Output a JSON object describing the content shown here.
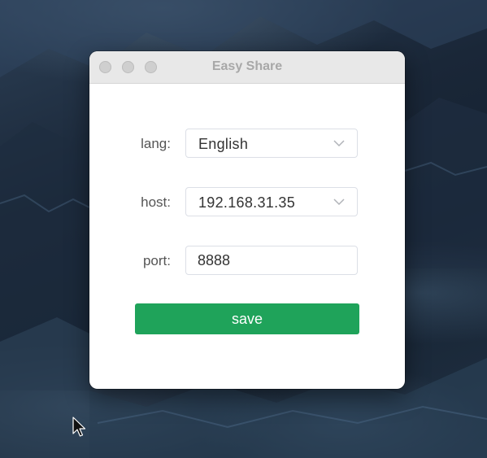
{
  "window": {
    "title": "Easy Share"
  },
  "form": {
    "lang": {
      "label": "lang:",
      "value": "English"
    },
    "host": {
      "label": "host:",
      "value": "192.168.31.35"
    },
    "port": {
      "label": "port:",
      "value": "8888"
    },
    "save_label": "save"
  },
  "colors": {
    "accent": "#1fa35a",
    "titlebar": "#e8e8e8",
    "title_text": "#a8a8a8"
  },
  "icons": [
    "chevron-down-icon",
    "mouse-cursor-icon"
  ]
}
